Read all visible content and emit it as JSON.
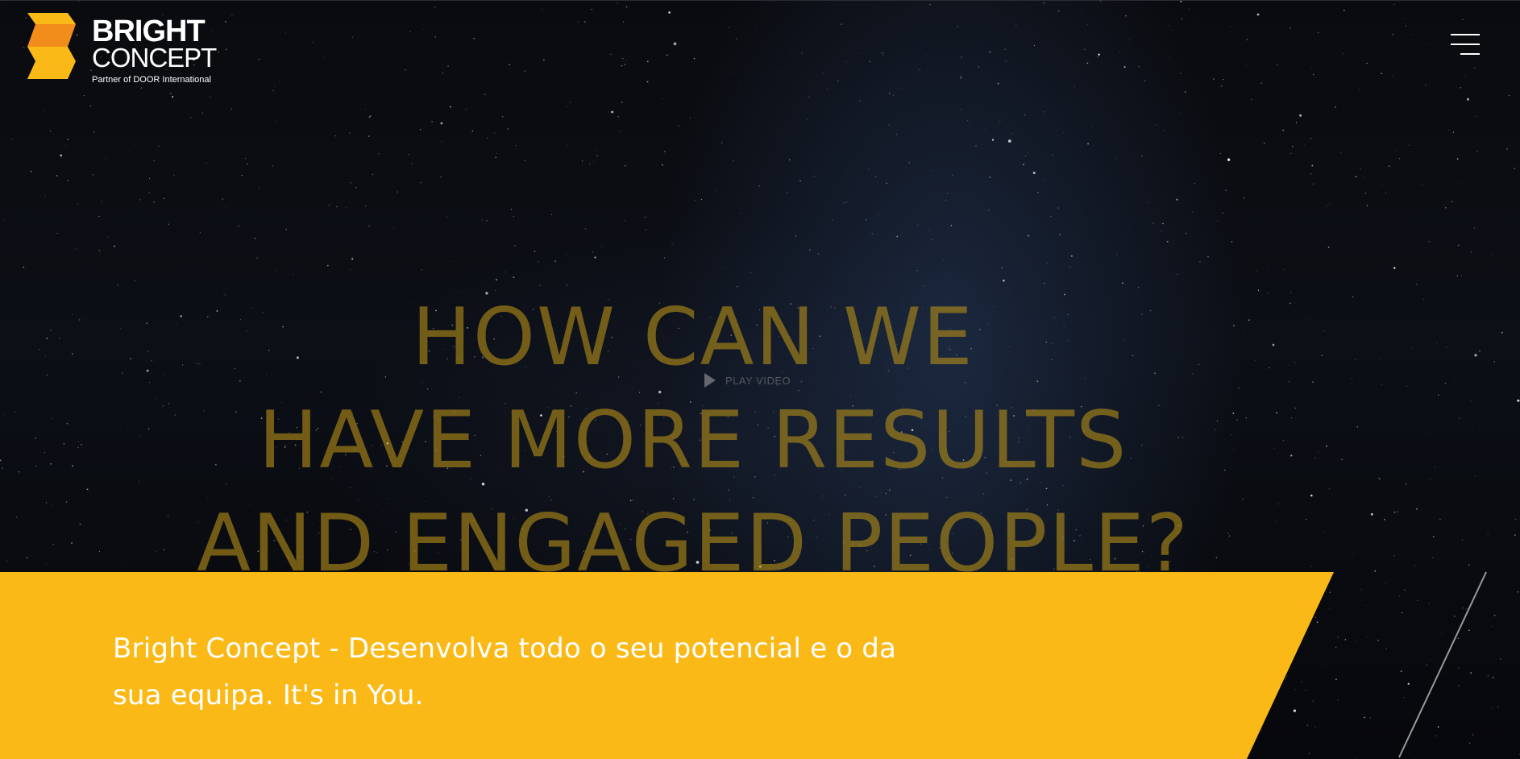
{
  "brand": {
    "line1": "BRIGHT",
    "line2": "CONCEPT",
    "tagline": "Partner of DOOR International",
    "colors": {
      "orange": "#fbb917",
      "dark_orange": "#f28c1a"
    }
  },
  "header": {
    "menu_icon": "hamburger-menu-icon"
  },
  "hero": {
    "headline_lines": [
      "HOW CAN WE",
      "HAVE MORE RESULTS",
      "AND ENGAGED PEOPLE?"
    ],
    "play_label": "PLAY VIDEO",
    "play_icon": "play-icon",
    "tagline": "Bright Concept - Desenvolva todo o seu potencial e o da sua equipa. It's in You.",
    "colors": {
      "background": "#07080b",
      "band": "#fbb917",
      "headline": "#b28c18"
    }
  }
}
